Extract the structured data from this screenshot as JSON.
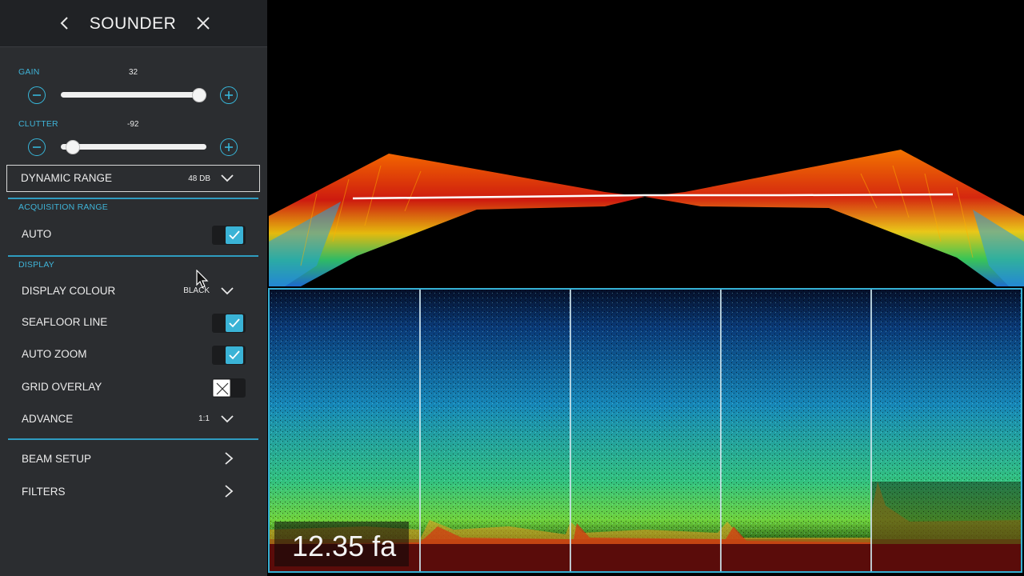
{
  "panel": {
    "title": "SOUNDER",
    "gain": {
      "label": "GAIN",
      "value": "32",
      "level": 0.95
    },
    "clutter": {
      "label": "CLUTTER",
      "value": "-92",
      "level": 0.08
    },
    "dynamic_range": {
      "label": "DYNAMIC RANGE",
      "value": "48 DB"
    },
    "acquisition_range": {
      "section": "ACQUISITION RANGE",
      "auto_label": "AUTO",
      "auto_checked": true
    },
    "display": {
      "section": "DISPLAY",
      "colour_label": "DISPLAY COLOUR",
      "colour_value": "BLACK",
      "seafloor_label": "SEAFLOOR LINE",
      "seafloor_checked": true,
      "autozoom_label": "AUTO ZOOM",
      "autozoom_checked": true,
      "grid_label": "GRID OVERLAY",
      "grid_checked": false,
      "advance_label": "ADVANCE",
      "advance_value": "1:1"
    },
    "nav": {
      "beam_setup": "BEAM SETUP",
      "filters": "FILTERS"
    }
  },
  "sonar": {
    "depth_readout": "12.35 fa",
    "column_count": 5
  },
  "colors": {
    "accent": "#37b6d9",
    "panel_bg": "#2b2d30",
    "header_bg": "#202225"
  }
}
